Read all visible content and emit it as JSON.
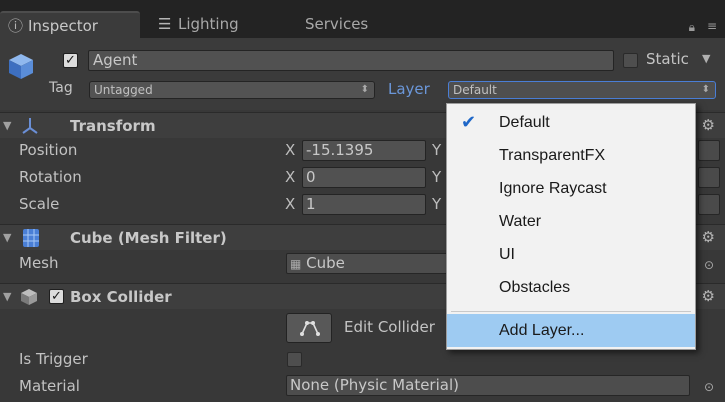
{
  "tabs": [
    {
      "label": "Inspector",
      "icon": "info-icon",
      "active": true
    },
    {
      "label": "Lighting",
      "icon": "sliders-icon",
      "active": false
    },
    {
      "label": "Services",
      "active": false
    }
  ],
  "header": {
    "active_checked": true,
    "name": "Agent",
    "static_label": "Static",
    "static_checked": false,
    "tag_label": "Tag",
    "tag_value": "Untagged",
    "layer_label": "Layer",
    "layer_value": "Default"
  },
  "transform": {
    "title": "Transform",
    "position_label": "Position",
    "rotation_label": "Rotation",
    "scale_label": "Scale",
    "x_axis": "X",
    "y_axis": "Y",
    "position_x": "-15.1395",
    "rotation_x": "0",
    "scale_x": "1"
  },
  "mesh_filter": {
    "title": "Cube (Mesh Filter)",
    "mesh_label": "Mesh",
    "mesh_value": "Cube"
  },
  "box_collider": {
    "title": "Box Collider",
    "enabled": true,
    "edit_label": "Edit Collider",
    "is_trigger_label": "Is Trigger",
    "is_trigger_checked": false,
    "material_label": "Material",
    "material_value": "None (Physic Material)"
  },
  "layer_menu": {
    "items": [
      "Default",
      "TransparentFX",
      "Ignore Raycast",
      "Water",
      "UI",
      "Obstacles"
    ],
    "selected": "Default",
    "add_layer": "Add Layer..."
  },
  "colors": {
    "panel": "#383838",
    "accent": "#6b97d9",
    "menu_highlight": "#9ecbf2",
    "check": "#1e67c8"
  }
}
